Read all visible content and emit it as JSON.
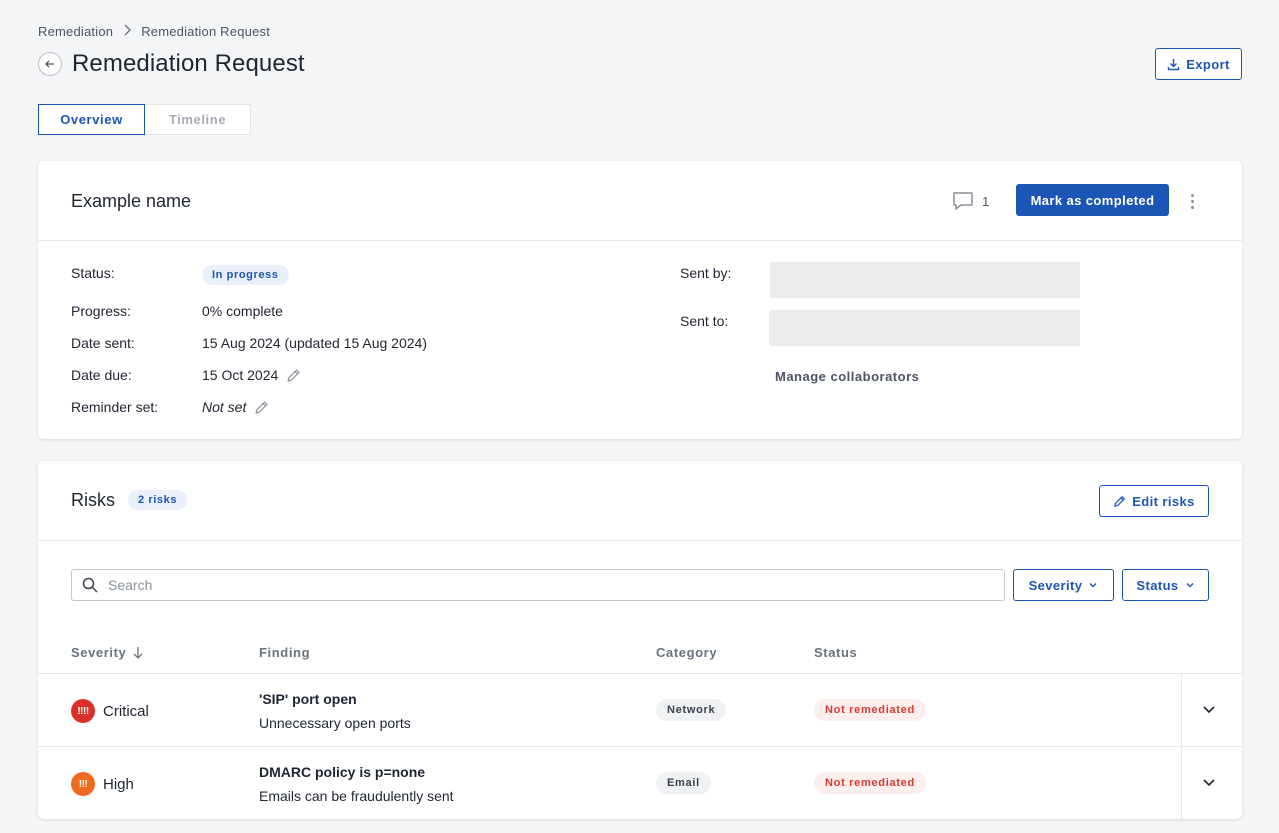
{
  "breadcrumb": {
    "root": "Remediation",
    "current": "Remediation Request"
  },
  "header": {
    "title": "Remediation Request",
    "export_label": "Export"
  },
  "tabs": [
    {
      "label": "Overview",
      "active": true
    },
    {
      "label": "Timeline",
      "active": false
    }
  ],
  "request": {
    "name": "Example name",
    "comment_count": "1",
    "mark_completed_label": "Mark as completed",
    "fields": {
      "status_label": "Status:",
      "status_value": "In progress",
      "progress_label": "Progress:",
      "progress_value": "0% complete",
      "date_sent_label": "Date sent:",
      "date_sent_value": "15 Aug 2024 (updated 15 Aug 2024)",
      "date_due_label": "Date due:",
      "date_due_value": "15 Oct 2024",
      "reminder_label": "Reminder set:",
      "reminder_value": "Not set",
      "sent_by_label": "Sent by:",
      "sent_to_label": "Sent to:",
      "manage_collaborators_label": "Manage collaborators"
    }
  },
  "risks": {
    "title": "Risks",
    "count_label": "2 risks",
    "edit_label": "Edit risks",
    "search_placeholder": "Search",
    "filters": {
      "severity": "Severity",
      "status": "Status"
    },
    "columns": {
      "severity": "Severity",
      "finding": "Finding",
      "category": "Category",
      "status": "Status"
    },
    "rows": [
      {
        "severity": "Critical",
        "severity_glyph": "!!!!",
        "severity_color": "#d9302a",
        "finding_title": "'SIP' port open",
        "finding_sub": "Unnecessary open ports",
        "category": "Network",
        "status": "Not remediated"
      },
      {
        "severity": "High",
        "severity_glyph": "!!!",
        "severity_color": "#f06a1f",
        "finding_title": "DMARC policy is p=none",
        "finding_sub": "Emails can be fraudulently sent",
        "category": "Email",
        "status": "Not remediated"
      }
    ]
  },
  "colors": {
    "accent": "#1b55b5",
    "danger": "#d43b2f"
  }
}
